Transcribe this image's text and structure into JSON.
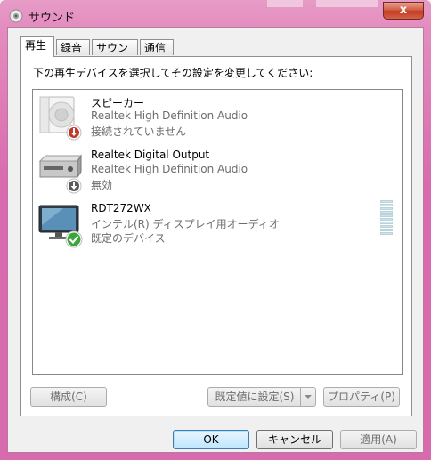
{
  "window": {
    "title": "サウンド",
    "close_label": "x"
  },
  "tabs": [
    {
      "label": "再生",
      "active": true
    },
    {
      "label": "録音",
      "active": false
    },
    {
      "label": "サウンド",
      "active": false
    },
    {
      "label": "通信",
      "active": false
    }
  ],
  "instruction": "下の再生デバイスを選択してその設定を変更してください:",
  "devices": [
    {
      "name": "スピーカー",
      "driver": "Realtek High Definition Audio",
      "status": "接続されていません",
      "icon": "speaker-icon",
      "badge": "disconnected-badge"
    },
    {
      "name": "Realtek Digital Output",
      "driver": "Realtek High Definition Audio",
      "status": "無効",
      "icon": "digital-output-icon",
      "badge": "disabled-badge"
    },
    {
      "name": "RDT272WX",
      "driver": "インテル(R) ディスプレイ用オーディオ",
      "status": "既定のデバイス",
      "icon": "monitor-icon",
      "badge": "default-check-badge",
      "level_bars": 10
    }
  ],
  "buttons": {
    "configure": "構成(C)",
    "set_default": "既定値に設定(S)",
    "properties": "プロパティ(P)",
    "ok": "OK",
    "cancel": "キャンセル",
    "apply": "適用(A)"
  },
  "colors": {
    "titlebar": "#d96aaf",
    "close_button": "#c23b20",
    "default_badge": "#3aa53a",
    "disconnected_badge": "#c0392b"
  }
}
